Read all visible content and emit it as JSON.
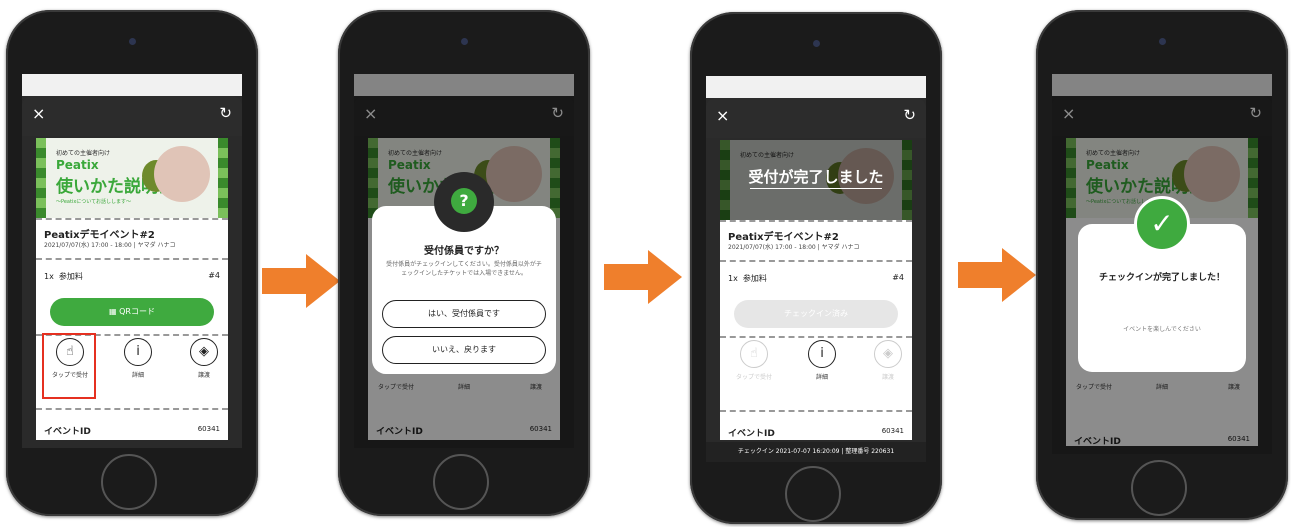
{
  "colors": {
    "accent": "#3faa3f",
    "arrow": "#ef7f2c",
    "highlight": "#e53020"
  },
  "header": {
    "close_icon": "×",
    "refresh_icon": "↻"
  },
  "banner": {
    "sub": "初めての主催者向け",
    "brand": "Peatix",
    "title": "使いかた説明会",
    "caption": "～Peatixについてお話しします～",
    "overlay_done": "受付が完了しました"
  },
  "ticket": {
    "title": "Peatixデモイベント#2",
    "date": "2021/07/07(水) 17:00 - 18:00 | ヤマダ ハナコ",
    "qty": "1x",
    "type": "参加料",
    "num": "#4",
    "qr_button": "QRコード",
    "checked_button": "チェックイン済み",
    "actions": [
      "タップで受付",
      "詳細",
      "譲渡"
    ],
    "id_label": "イベントID",
    "id_value": "60341",
    "checkin_footer": "チェックイン 2021-07-07 16:20:09 | 整理番号 220631"
  },
  "modal_staff": {
    "title": "受付係員ですか？",
    "body": "受付係員がチェックインしてください。受付係員以外がチェックインしたチケットでは入場できません。",
    "yes": "はい、受付係員です",
    "no": "いいえ、戻ります"
  },
  "modal_done": {
    "title": "チェックインが完了しました！",
    "body": "イベントを楽しんでください"
  }
}
